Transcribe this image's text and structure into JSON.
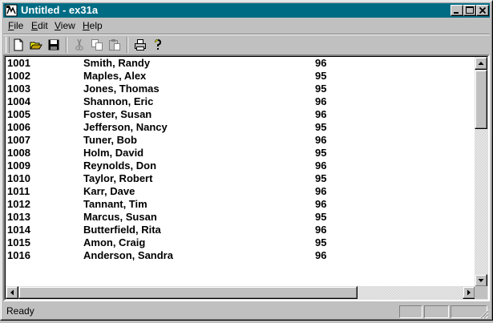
{
  "window": {
    "title": "Untitled - ex31a"
  },
  "menu": [
    {
      "accel": "F",
      "rest": "ile"
    },
    {
      "accel": "E",
      "rest": "dit"
    },
    {
      "accel": "V",
      "rest": "iew"
    },
    {
      "accel": "H",
      "rest": "elp"
    }
  ],
  "toolbar": {
    "buttons": [
      "new-document-icon",
      "open-folder-icon",
      "save-disk-icon",
      "cut-scissors-icon",
      "copy-icon",
      "paste-clipboard-icon",
      "print-icon",
      "help-question-icon"
    ]
  },
  "rows": [
    {
      "id": "1001",
      "name": "Smith, Randy",
      "score": "96"
    },
    {
      "id": "1002",
      "name": "Maples, Alex",
      "score": "95"
    },
    {
      "id": "1003",
      "name": "Jones, Thomas",
      "score": "95"
    },
    {
      "id": "1004",
      "name": "Shannon, Eric",
      "score": "96"
    },
    {
      "id": "1005",
      "name": "Foster, Susan",
      "score": "96"
    },
    {
      "id": "1006",
      "name": "Jefferson, Nancy",
      "score": "95"
    },
    {
      "id": "1007",
      "name": "Tuner, Bob",
      "score": "96"
    },
    {
      "id": "1008",
      "name": "Holm, David",
      "score": "95"
    },
    {
      "id": "1009",
      "name": "Reynolds, Don",
      "score": "96"
    },
    {
      "id": "1010",
      "name": "Taylor, Robert",
      "score": "95"
    },
    {
      "id": "1011",
      "name": "Karr, Dave",
      "score": "96"
    },
    {
      "id": "1012",
      "name": "Tannant, Tim",
      "score": "96"
    },
    {
      "id": "1013",
      "name": "Marcus, Susan",
      "score": "95"
    },
    {
      "id": "1014",
      "name": "Butterfield, Rita",
      "score": "96"
    },
    {
      "id": "1015",
      "name": "Amon, Craig",
      "score": "95"
    },
    {
      "id": "1016",
      "name": "Anderson, Sandra",
      "score": "96"
    }
  ],
  "status": {
    "text": "Ready"
  },
  "colors": {
    "titlebar": "#006c84",
    "face": "#c0c0c0",
    "client": "#ffffff"
  }
}
